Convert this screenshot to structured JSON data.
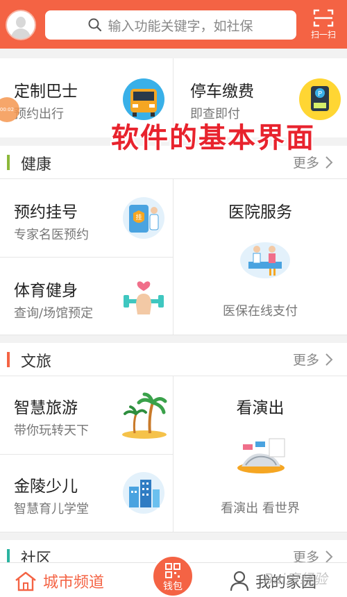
{
  "header": {
    "search_placeholder": "输入功能关键字，如社保",
    "scan_label": "扫一扫"
  },
  "overlay": {
    "caption": "软件的基本界面",
    "float_badge": "00:02"
  },
  "top_services": [
    {
      "title": "定制巴士",
      "subtitle": "预约出行",
      "icon": "bus-icon"
    },
    {
      "title": "停车缴费",
      "subtitle": "即查即付",
      "icon": "parking-icon"
    }
  ],
  "sections": [
    {
      "title": "健康",
      "more": "更多",
      "accent": "#8cb83a",
      "items": [
        {
          "title": "预约挂号",
          "subtitle": "专家名医预约",
          "icon": "registration-icon"
        },
        {
          "title": "医院服务",
          "subtitle": "医保在线支付",
          "icon": "hospital-icon"
        },
        {
          "title": "体育健身",
          "subtitle": "查询/场馆预定",
          "icon": "fitness-icon"
        }
      ]
    },
    {
      "title": "文旅",
      "more": "更多",
      "accent": "#f46344",
      "items": [
        {
          "title": "智慧旅游",
          "subtitle": "带你玩转天下",
          "icon": "palm-tree-icon"
        },
        {
          "title": "看演出",
          "subtitle": "看演出  看世界",
          "icon": "theater-icon"
        },
        {
          "title": "金陵少儿",
          "subtitle": "智慧育儿学堂",
          "icon": "building-icon"
        }
      ]
    },
    {
      "title": "社区",
      "more": "更多",
      "accent": "#2bb3a0"
    }
  ],
  "bottom_nav": {
    "left_label": "城市频道",
    "center_label": "钱包",
    "right_label": "我的家园",
    "watermark": "Bai度经验"
  },
  "colors": {
    "brand": "#f46344",
    "health_accent": "#8cb83a",
    "culture_accent": "#f46344",
    "community_accent": "#2bb3a0"
  }
}
